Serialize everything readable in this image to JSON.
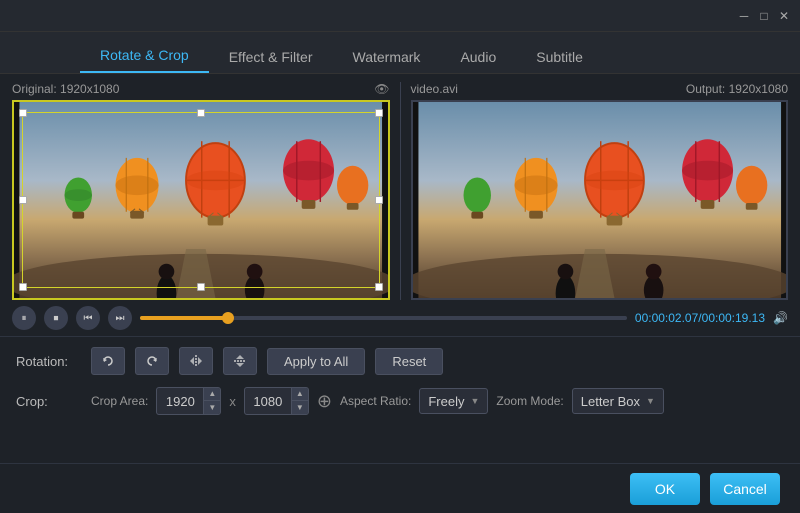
{
  "titleBar": {
    "minimizeLabel": "─",
    "maximizeLabel": "□",
    "closeLabel": "✕"
  },
  "tabs": [
    {
      "id": "rotate-crop",
      "label": "Rotate & Crop",
      "active": true
    },
    {
      "id": "effect-filter",
      "label": "Effect & Filter",
      "active": false
    },
    {
      "id": "watermark",
      "label": "Watermark",
      "active": false
    },
    {
      "id": "audio",
      "label": "Audio",
      "active": false
    },
    {
      "id": "subtitle",
      "label": "Subtitle",
      "active": false
    }
  ],
  "leftPanel": {
    "original": "Original: 1920x1080"
  },
  "rightPanel": {
    "filename": "video.avi",
    "output": "Output: 1920x1080"
  },
  "playback": {
    "currentTime": "00:00:02.07",
    "totalTime": "00:00:19.13",
    "progressPercent": 18
  },
  "rotation": {
    "label": "Rotation:",
    "applyToAll": "Apply to All",
    "reset": "Reset"
  },
  "crop": {
    "label": "Crop:",
    "cropAreaLabel": "Crop Area:",
    "width": "1920",
    "height": "1080",
    "xLabel": "x",
    "aspectRatioLabel": "Aspect Ratio:",
    "aspectRatioValue": "Freely",
    "zoomModeLabel": "Zoom Mode:",
    "zoomModeValue": "Letter Box"
  },
  "footer": {
    "okLabel": "OK",
    "cancelLabel": "Cancel"
  }
}
